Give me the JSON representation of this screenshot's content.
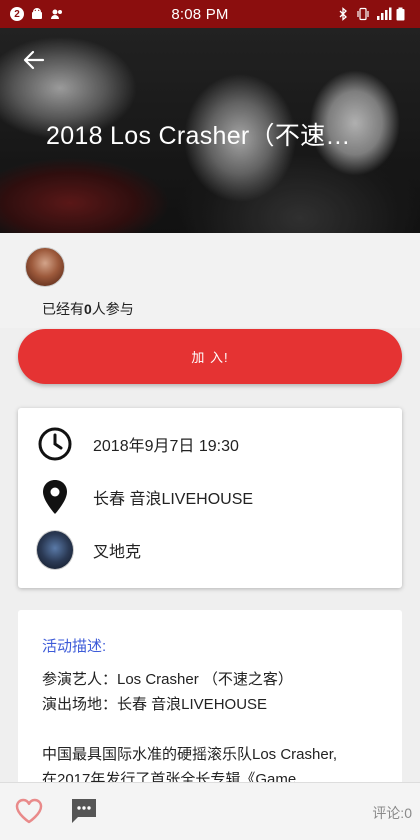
{
  "status_bar": {
    "notification_count": "2",
    "time": "8:08 PM"
  },
  "header": {
    "title": "2018 Los Crasher（不速…"
  },
  "participants": {
    "prefix": "已经有",
    "count": "0",
    "suffix": "人参与"
  },
  "join_button": {
    "label": "加 入!"
  },
  "info": {
    "datetime": "2018年9月7日 19:30",
    "location": "长春 音浪LIVEHOUSE",
    "organizer": "叉地克"
  },
  "description": {
    "title": "活动描述:",
    "lines": [
      "参演艺人：Los Crasher （不速之客）",
      "演出场地：长春 音浪LIVEHOUSE",
      "中国最具国际水准的硬摇滚乐队Los Crasher,",
      "在2017年发行了首张全长专辑《Game"
    ]
  },
  "bottom_bar": {
    "comment_label": "评论:0"
  },
  "colors": {
    "status_bar": "#8b0e0e",
    "accent_red": "#e53333",
    "desc_title": "#3d5bd8",
    "like_heart": "#e98a8a"
  }
}
